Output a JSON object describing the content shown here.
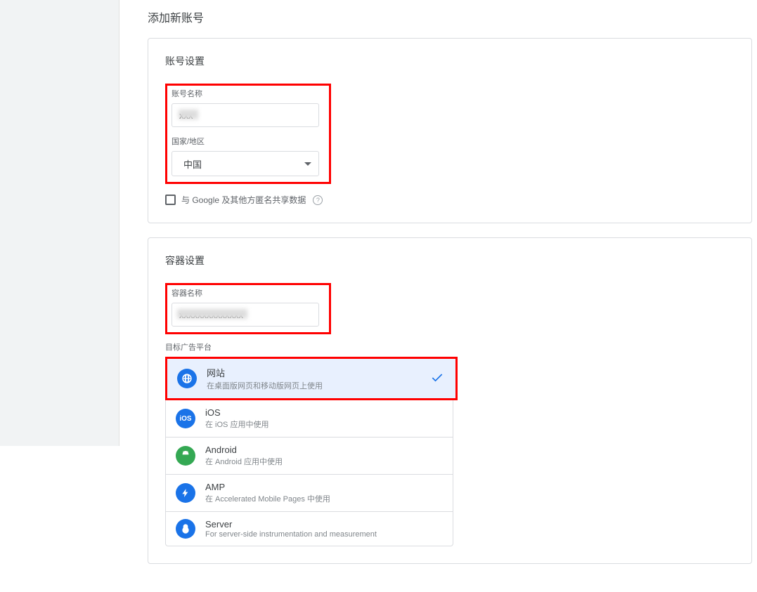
{
  "page_title": "添加新账号",
  "account_section": {
    "title": "账号设置",
    "name_label": "账号名称",
    "name_value": "xxx",
    "country_label": "国家/地区",
    "country_value": "中国",
    "share_checkbox_label": "与 Google 及其他方匿名共享数据",
    "help_icon": "?"
  },
  "container_section": {
    "title": "容器设置",
    "name_label": "容器名称",
    "name_value": "xxxxxxxxxxxxxx",
    "platform_label": "目标广告平台",
    "platforms": [
      {
        "key": "web",
        "title": "网站",
        "desc": "在桌面版网页和移动版网页上使用",
        "color": "#1a73e8",
        "selected": true
      },
      {
        "key": "ios",
        "title": "iOS",
        "desc": "在 iOS 应用中使用",
        "color": "#1a73e8",
        "selected": false
      },
      {
        "key": "android",
        "title": "Android",
        "desc": "在 Android 应用中使用",
        "color": "#34a853",
        "selected": false
      },
      {
        "key": "amp",
        "title": "AMP",
        "desc": "在 Accelerated Mobile Pages 中使用",
        "color": "#1a73e8",
        "selected": false
      },
      {
        "key": "server",
        "title": "Server",
        "desc": "For server-side instrumentation and measurement",
        "color": "#1a73e8",
        "selected": false
      }
    ]
  }
}
